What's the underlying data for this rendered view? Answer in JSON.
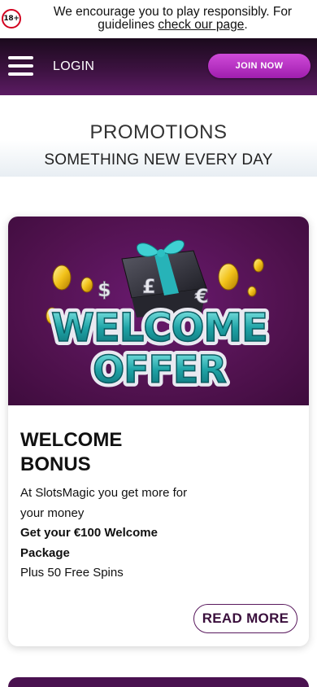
{
  "banner": {
    "age_badge": "18+",
    "text_before": "We encourage you to play responsibly. For guidelines ",
    "link_text": "check our page",
    "text_after": "."
  },
  "header": {
    "menu_icon": "hamburger-menu-icon",
    "login_label": "LOGIN",
    "join_label": "JOIN NOW"
  },
  "promotions": {
    "title": "PROMOTIONS",
    "subtitle": "SOMETHING NEW EVERY DAY"
  },
  "cards": [
    {
      "image_line1": "WELCOME",
      "image_line2": "OFFER",
      "image_icons": [
        "gift-box-icon",
        "gold-coin-icon",
        "dollar-sign-icon",
        "pound-sign-icon",
        "euro-sign-icon"
      ],
      "title": "WELCOME BONUS",
      "desc_line1": "At SlotsMagic you get more for your money",
      "desc_line2": "Get your €100 Welcome Package",
      "desc_line3": "Plus 50 Free Spins",
      "button_label": "READ MORE"
    }
  ],
  "colors": {
    "header_dark": "#1b0a1d",
    "header_purple": "#5b1b63",
    "join_button": "#c03ccb",
    "card_hero": "#51124f",
    "offer_text": "#1fa3a6",
    "badge_red": "#d2001f"
  }
}
